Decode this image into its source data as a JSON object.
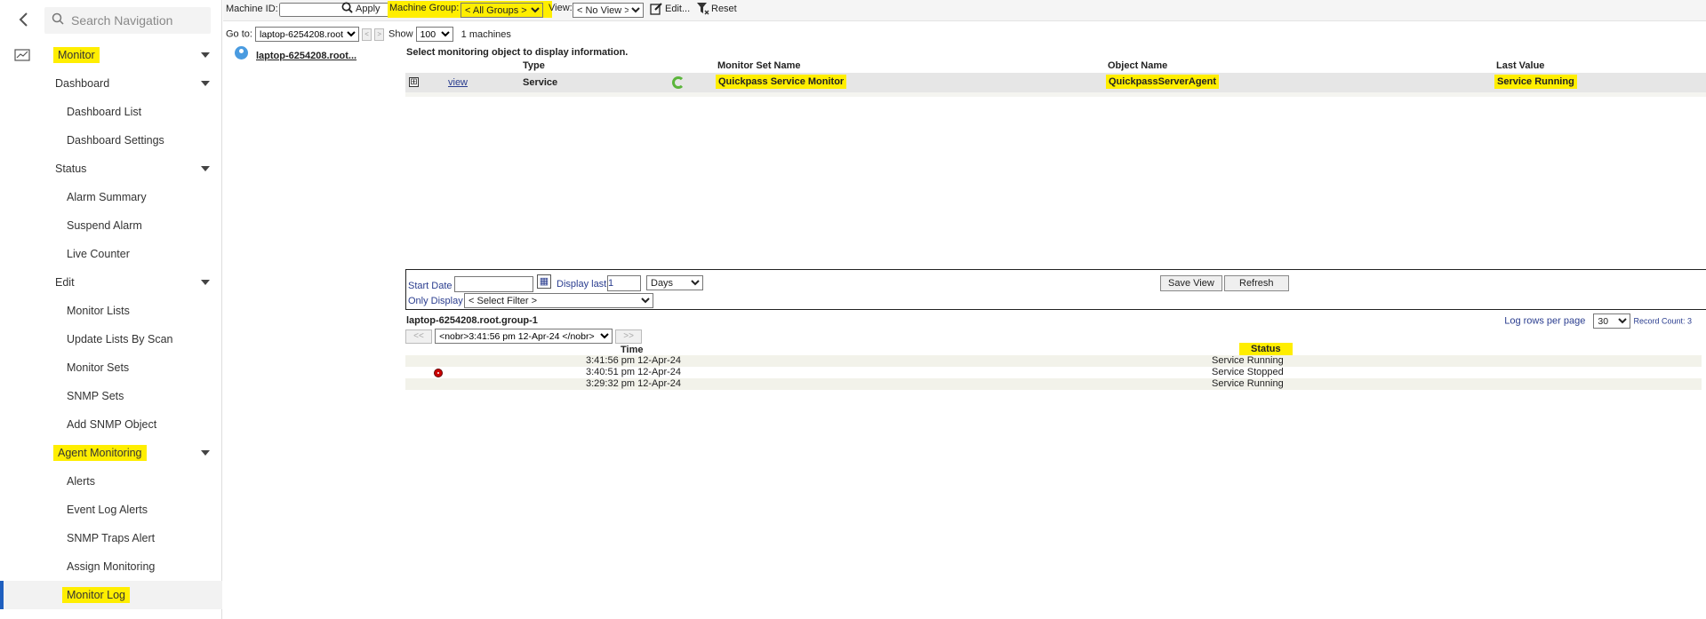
{
  "sidebar": {
    "search_placeholder": "Search Navigation",
    "items": [
      {
        "label": "Monitor"
      },
      {
        "label": "Dashboard"
      },
      {
        "label": "Dashboard List"
      },
      {
        "label": "Dashboard Settings"
      },
      {
        "label": "Status"
      },
      {
        "label": "Alarm Summary"
      },
      {
        "label": "Suspend Alarm"
      },
      {
        "label": "Live Counter"
      },
      {
        "label": "Edit"
      },
      {
        "label": "Monitor Lists"
      },
      {
        "label": "Update Lists By Scan"
      },
      {
        "label": "Monitor Sets"
      },
      {
        "label": "SNMP Sets"
      },
      {
        "label": "Add SNMP Object"
      },
      {
        "label": "Agent Monitoring"
      },
      {
        "label": "Alerts"
      },
      {
        "label": "Event Log Alerts"
      },
      {
        "label": "SNMP Traps Alert"
      },
      {
        "label": "Assign Monitoring"
      },
      {
        "label": "Monitor Log"
      }
    ]
  },
  "toolbar": {
    "machine_id_label": "Machine ID:",
    "machine_id_value": "",
    "apply_label": "Apply",
    "machine_group_label": "Machine Group:",
    "machine_group_value": "< All Groups >",
    "view_label": "View:",
    "view_value": "< No View >",
    "edit_label": "Edit...",
    "reset_label": "Reset"
  },
  "goto": {
    "label": "Go to:",
    "value": "laptop-6254208.root",
    "show_label": "Show",
    "show_value": "100",
    "machine_count": "1 machines"
  },
  "machine_link": "laptop-6254208.root...",
  "monitor": {
    "select_message": "Select monitoring object to display information.",
    "headers": {
      "type": "Type",
      "set_name": "Monitor Set Name",
      "object_name": "Object Name",
      "last_value": "Last Value"
    },
    "row": {
      "expander": "⊞",
      "view": "view",
      "type": "Service",
      "set_name": "Quickpass Service Monitor",
      "object_name": "QuickpassServerAgent",
      "last_value": "Service Running"
    }
  },
  "filter": {
    "start_date_label": "Start Date",
    "start_date_value": "",
    "display_last_label": "Display last",
    "display_last_value": "1",
    "unit_value": "Days",
    "only_display_label": "Only Display",
    "filter_value": "< Select Filter >",
    "save_view_label": "Save View",
    "refresh_label": "Refresh"
  },
  "log": {
    "group_name": "laptop-6254208.root.group-1",
    "log_rows_label": "Log rows per page",
    "log_rows_value": "30",
    "record_count": "Record Count: 3",
    "prev_label": "<<",
    "next_label": ">>",
    "page_select_value": "<nobr>3:41:56 pm 12-Apr-24 </nobr>",
    "headers": {
      "time": "Time",
      "status": "Status"
    },
    "rows": [
      {
        "time": "3:41:56 pm 12-Apr-24",
        "status": "Service Running"
      },
      {
        "time": "3:40:51 pm 12-Apr-24",
        "status": "Service Stopped"
      },
      {
        "time": "3:29:32 pm 12-Apr-24",
        "status": "Service Running"
      }
    ]
  },
  "colors": {
    "highlight": "#ffee00",
    "active_bar": "#1f5fbf",
    "link": "#2a3d8f"
  }
}
